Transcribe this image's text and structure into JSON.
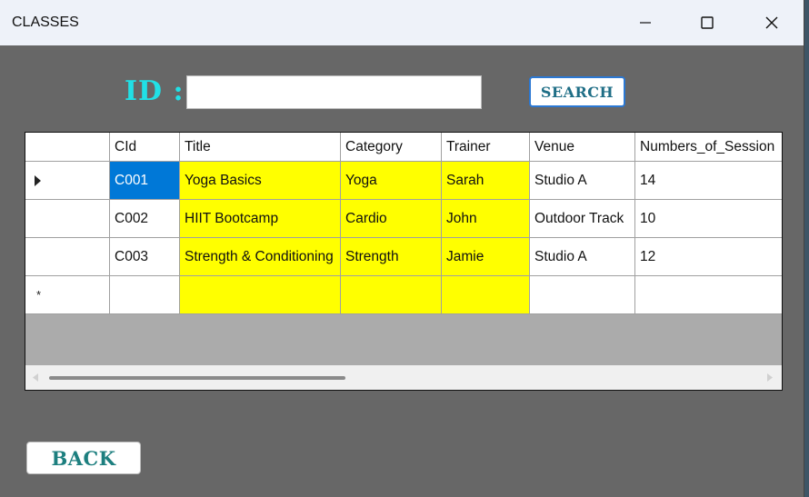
{
  "window": {
    "title": "CLASSES",
    "minimize_glyph": "—",
    "maximize_glyph": "☐",
    "close_glyph": "✕"
  },
  "search": {
    "label": "ID :",
    "value": "",
    "placeholder": "",
    "button_label": "SEARCH"
  },
  "table": {
    "columns": [
      "CId",
      "Title",
      "Category",
      "Trainer",
      "Venue",
      "Numbers_of_Session"
    ],
    "rows": [
      [
        "C001",
        "Yoga Basics",
        "Yoga",
        "Sarah",
        "Studio A",
        "14"
      ],
      [
        "C002",
        "HIIT Bootcamp",
        "Cardio",
        "John",
        "Outdoor Track",
        "10"
      ],
      [
        "C003",
        "Strength & Conditioning",
        "Strength",
        "Jamie",
        "Studio A",
        "12"
      ]
    ],
    "new_row_marker": "*",
    "selected_row": 0
  },
  "footer": {
    "back_label": "BACK"
  },
  "colors": {
    "id_label": "#21e0e6",
    "highlight_columns": "#ffff00",
    "selection": "#0078d7",
    "window_bg": "#676767"
  }
}
